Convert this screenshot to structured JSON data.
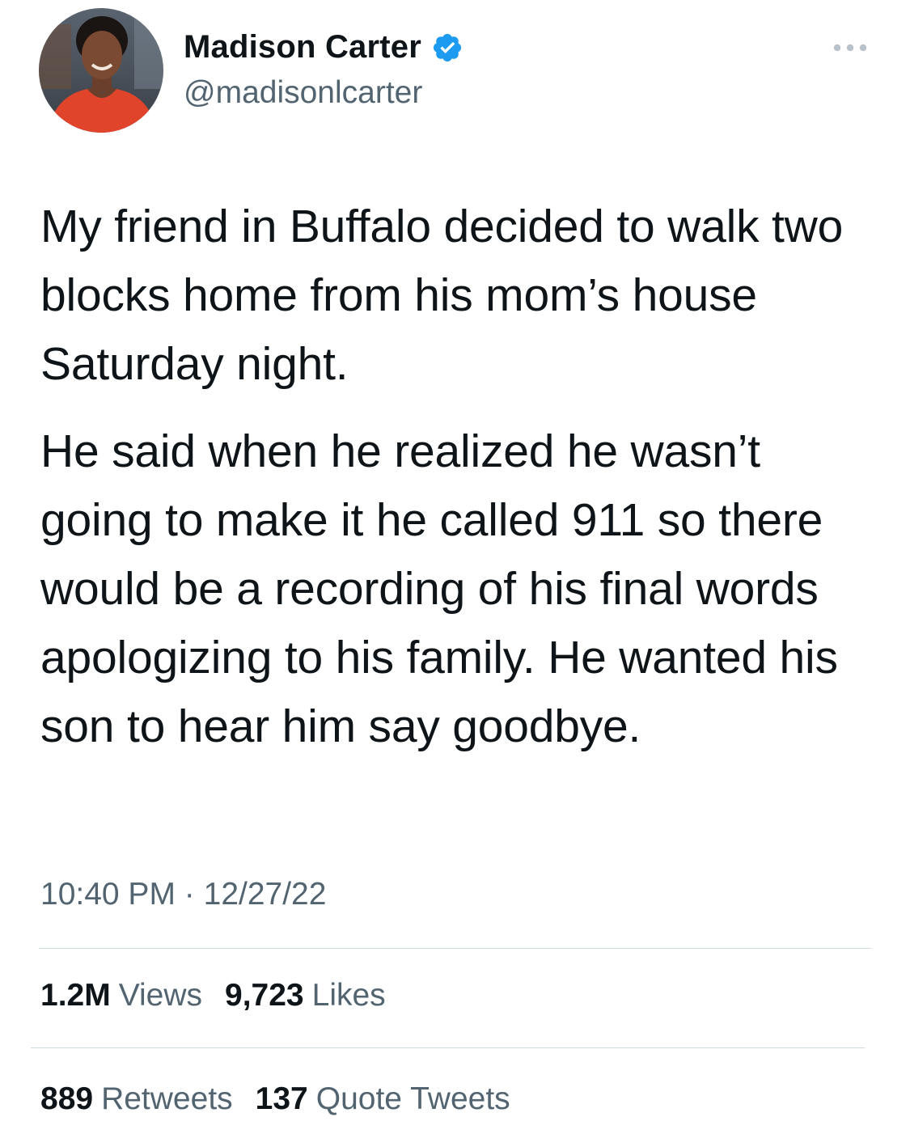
{
  "user": {
    "display_name": "Madison Carter",
    "handle": "@madisonlcarter",
    "verified": true,
    "verified_icon": "verified-badge-icon",
    "verified_color": "#1d9bf0"
  },
  "more_icon": "more-horizontal-icon",
  "tweet": {
    "paragraphs": [
      "My friend in Buffalo decided to walk two blocks home from his mom’s house Saturday night.",
      "He said when he realized he wasn’t going to make it he called 911 so there would be a recording of his final words apologizing to his family. He wanted his son to hear him say goodbye."
    ],
    "time": "10:40 PM",
    "separator": "·",
    "date": "12/27/22"
  },
  "stats": {
    "views": {
      "count": "1.2M",
      "label": "Views"
    },
    "likes": {
      "count": "9,723",
      "label": "Likes"
    },
    "retweets": {
      "count": "889",
      "label": "Retweets"
    },
    "quote_tweets": {
      "count": "137",
      "label": "Quote Tweets"
    }
  },
  "colors": {
    "text_primary": "#0f1419",
    "text_secondary": "#536471",
    "divider": "#cfd9de",
    "accent": "#1d9bf0"
  }
}
